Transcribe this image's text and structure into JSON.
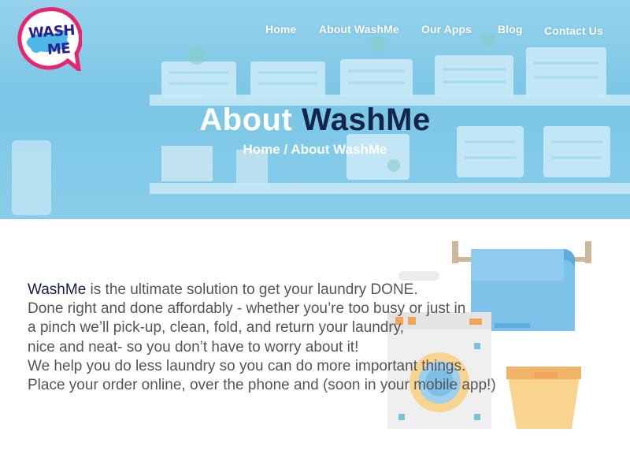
{
  "logo": {
    "line1": "WASH",
    "line2": "ME"
  },
  "nav": {
    "items": [
      {
        "label": "Home"
      },
      {
        "label": "About WashMe"
      },
      {
        "label": "Our Apps"
      },
      {
        "label": "Blog"
      },
      {
        "label": "Contact Us"
      }
    ]
  },
  "hero": {
    "title_white": "About",
    "title_dark": "WashMe",
    "breadcrumb": {
      "home": "Home",
      "separator": " / ",
      "current": "About WashMe"
    }
  },
  "about": {
    "brand": "WashMe",
    "line1_rest": " is the ultimate solution to get your laundry DONE.",
    "line2": "Done right and done affordably - whether you’re too busy or just in",
    "line3": "a pinch we’ll pick-up, clean, fold, and return your laundry,",
    "line4": "nice and neat- so you don’t have to worry about it!",
    "line5": "We help you do less laundry so you can do more important things.",
    "line6": "Place your order online, over the phone and (soon in your mobile app!)"
  },
  "colors": {
    "hero_blue": "#7cc6e4",
    "logo_ring": "#e8246e",
    "logo_text": "#2c1f8f",
    "title_dark": "#13264a",
    "body_text": "#555555"
  }
}
